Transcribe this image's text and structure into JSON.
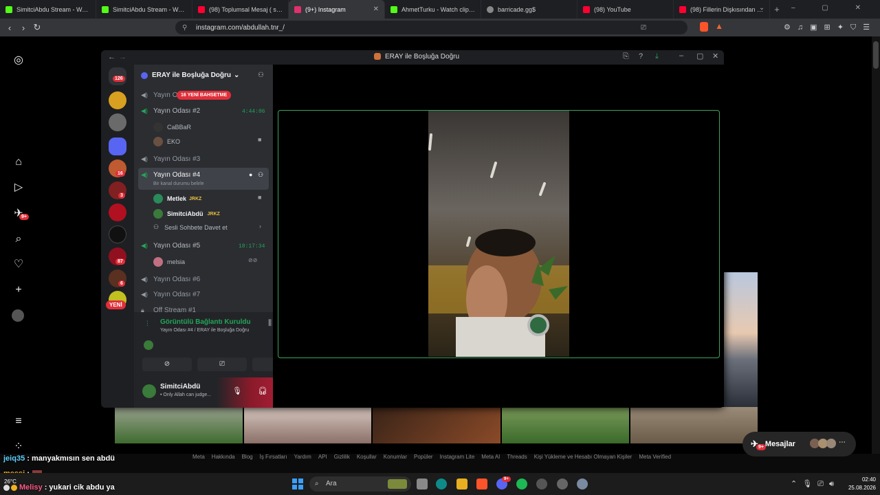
{
  "browser": {
    "tabs": [
      {
        "title": "SimitciAbdu Stream - Watch l",
        "color": "#53fc18"
      },
      {
        "title": "SimitciAbdu Stream - Watch l",
        "color": "#53fc18"
      },
      {
        "title": "(98) Toplumsal Mesaj ( suyu a",
        "color": "#ff0033"
      },
      {
        "title": "(9+) Instagram",
        "color": "#e1306c"
      },
      {
        "title": "AhmetTurku - Watch clips on",
        "color": "#53fc18"
      },
      {
        "title": "barricade.gg$",
        "color": "#888888"
      },
      {
        "title": "(98) YouTube",
        "color": "#ff0033"
      },
      {
        "title": "(98) Fillerin Dişkısından elde",
        "color": "#ff0033"
      }
    ],
    "new_tab": "+",
    "url": "instagram.com/abdullah.tnr_/"
  },
  "instagram": {
    "notif_badge": "9+",
    "messages_label": "Mesajlar",
    "messages_badge": "9+",
    "footer": [
      "Meta",
      "Hakkında",
      "Blog",
      "İş Fırsatları",
      "Yardım",
      "API",
      "Gizlilik",
      "Koşullar",
      "Konumlar",
      "Popüler",
      "Instagram Lite",
      "Meta AI",
      "Threads",
      "Kişi Yükleme ve Hesabı Olmayan Kişiler",
      "Meta Verified"
    ]
  },
  "discord": {
    "window_title": "ERAY ile Boşluğa Doğru",
    "server_name": "ERAY ile Boşluğa Doğru",
    "server_badges": {
      "dm": "126",
      "s1": "16",
      "s2": "3",
      "s3": "87",
      "s4": "6"
    },
    "new_label": "YENİ",
    "mention_pill": "16 YENİ BAHSETME",
    "channels": {
      "c1": "Yayın O",
      "c2": "Yayın Odası #2",
      "c2_timer": "4:44:06",
      "c2_users": [
        "CaBBaR",
        "EKO"
      ],
      "c3": "Yayın Odası #3",
      "c4": "Yayın Odası #4",
      "c4_status": "Bir kanal durumu belirle",
      "c4_users": [
        "Metlek",
        "SimitciAbdü"
      ],
      "tag": "JRKZ",
      "invite": "Sesli Sohbete Davet et",
      "c5": "Yayın Odası #5",
      "c5_timer": "18:17:34",
      "c5_user": "melsia",
      "c6": "Yayın Odası #6",
      "c7": "Yayın Odası #7",
      "off": "Off Stream #1"
    },
    "voice": {
      "status": "Görüntülü Bağlantı Kuruldu",
      "location": "Yayın Odası #4 / ERAY ile Boşluğa Doğru"
    },
    "user": {
      "name": "SimitciAbdü",
      "status": "• Only Allah can judge..."
    }
  },
  "chat": [
    {
      "user": "jeiq35",
      "text": " : manyakmısın sen abdü",
      "color": "#5fd3ff"
    },
    {
      "user": "messi",
      "text": " :",
      "color": "#f0b020"
    },
    {
      "user": "Melisy",
      "text": " : yukari cik abdu ya",
      "color": "#ff5a8a"
    }
  ],
  "taskbar": {
    "search": "Ara",
    "weather": "26°C",
    "time": "02:40",
    "date": "25.08.2026",
    "discord_badge": "9+"
  }
}
